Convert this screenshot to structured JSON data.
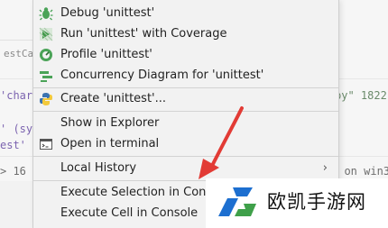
{
  "editor": {
    "tab_fragment": "estCa",
    "line_1": "'charc",
    "line_2": "' (sy:",
    "line_3": "est'",
    "line_4": "> 16",
    "right_fragment_1": "py\" 1822",
    "right_fragment_2": "] on win3"
  },
  "menu": {
    "items": [
      {
        "label": "Debug 'unittest'",
        "icon": "debug-icon"
      },
      {
        "label": "Run 'unittest' with Coverage",
        "icon": "run-coverage-icon"
      },
      {
        "label": "Profile 'unittest'",
        "icon": "profile-icon"
      },
      {
        "label": "Concurrency Diagram for 'unittest'",
        "icon": "concurrency-diagram-icon"
      },
      {
        "label": "Create 'unittest'...",
        "icon": "python-icon"
      },
      {
        "label": "Show in Explorer",
        "icon": ""
      },
      {
        "label": "Open in terminal",
        "icon": "terminal-icon"
      },
      {
        "label": "Local History",
        "icon": "",
        "submenu": "›"
      },
      {
        "label": "Execute Selection in Conso",
        "icon": ""
      },
      {
        "label": "Execute Cell in Console",
        "icon": ""
      }
    ]
  },
  "annotation": {
    "arrow_color": "#e23b35"
  },
  "watermark": {
    "text": "欧凯手游网"
  },
  "colors": {
    "menu_bg": "#f2f2f2",
    "accent_green": "#3fa04a",
    "watermark_blue": "#1d6fd0"
  }
}
